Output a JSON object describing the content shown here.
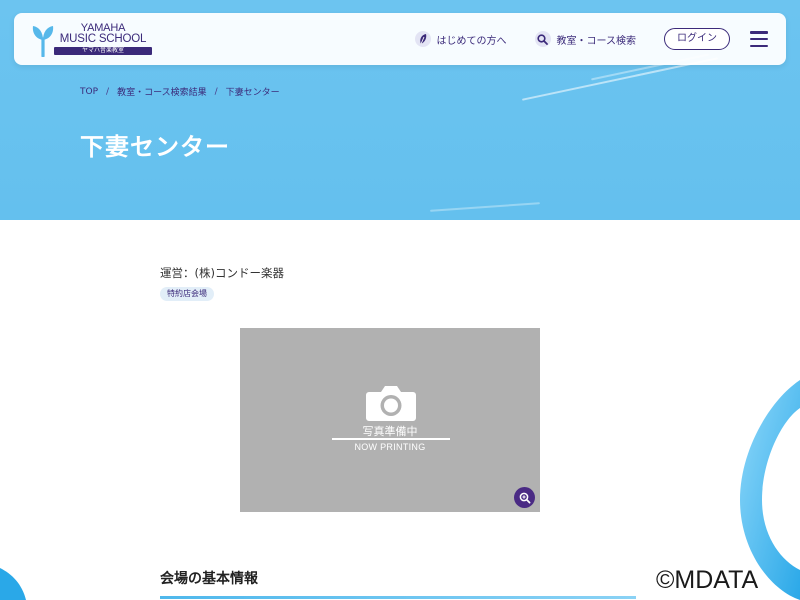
{
  "header": {
    "logo": {
      "line1": "YAMAHA",
      "line2": "MUSIC SCHOOL",
      "sub": "ヤマハ音楽教室"
    },
    "nav": {
      "first_time": "はじめての方へ",
      "search": "教室・コース検索",
      "login": "ログイン"
    }
  },
  "breadcrumb": {
    "items": [
      "TOP",
      "教室・コース検索結果",
      "下妻センター"
    ],
    "separator": "/"
  },
  "page_title": "下妻センター",
  "venue": {
    "operator": "運営：(株)コンドー楽器",
    "tag": "特約店会場"
  },
  "photo": {
    "placeholder_ja": "写真準備中",
    "placeholder_en": "NOW PRINTING"
  },
  "section": {
    "title": "会場の基本情報"
  },
  "watermark": "©MDATA",
  "colors": {
    "brand": "#3b2a7a",
    "hero_bg": "#6cc4f0",
    "accent_blue": "#4fb8ec",
    "photo_bg": "#b1b1b1",
    "zoom_button": "#4a2a84"
  },
  "icons": {
    "logo": "yamaha-sprout-logo",
    "first_time": "leaf-icon",
    "search": "search-icon",
    "menu": "hamburger-menu-icon",
    "photo": "camera-icon",
    "zoom": "zoom-in-icon"
  }
}
